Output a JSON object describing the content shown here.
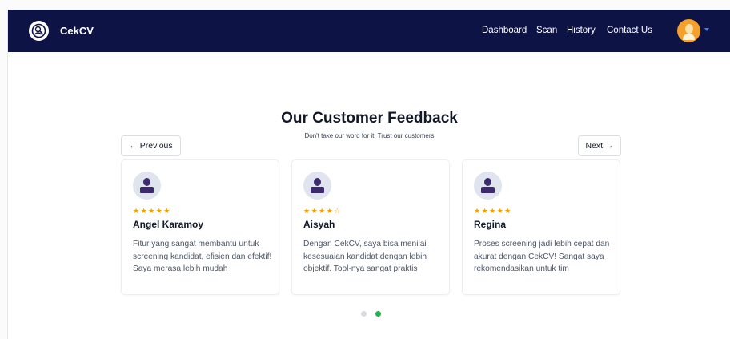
{
  "navbar": {
    "brand": "CekCV",
    "links": [
      "Dashboard",
      "Scan",
      "History",
      "Contact Us"
    ]
  },
  "section": {
    "title": "Our Customer Feedback",
    "subtitle": "Don't take our word for it. Trust our customers",
    "prev_label": "← Previous",
    "next_label": "Next →"
  },
  "testimonials": [
    {
      "name": "Angel Karamoy",
      "stars": "★★★★★",
      "text": "Fitur yang sangat membantu untuk screening kandidat, efisien dan efektif! Saya merasa lebih mudah"
    },
    {
      "name": "Aisyah",
      "stars": "★★★★☆",
      "text": "Dengan CekCV, saya bisa menilai kesesuaian kandidat dengan lebih objektif. Tool-nya sangat praktis"
    },
    {
      "name": "Regina",
      "stars": "★★★★★",
      "text": "Proses screening jadi lebih cepat dan akurat dengan CekCV! Sangat saya rekomendasikan untuk tim"
    }
  ],
  "pagination": {
    "total": 2,
    "active": 2
  },
  "colors": {
    "navbar": "#0e1346",
    "star": "#f2a000",
    "active_dot": "#1fb34a",
    "avatar": "#f5a02a"
  },
  "icons": [
    "logo-icon",
    "user-avatar-icon",
    "chevron-down-icon",
    "person-icon"
  ]
}
